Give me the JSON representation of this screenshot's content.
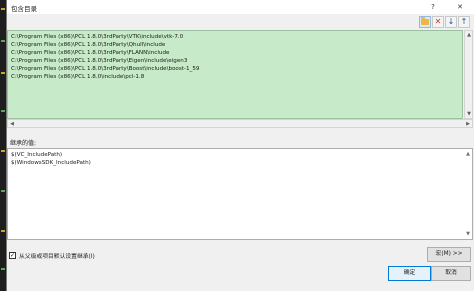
{
  "window": {
    "title": "包含目录",
    "help_glyph": "?",
    "close_glyph": "✕"
  },
  "toolbar": {
    "new_line_icon": "folder-icon",
    "delete_glyph": "✕",
    "move_down_glyph": "↓",
    "move_up_glyph": "↑"
  },
  "include_paths": [
    "C:\\Program Files (x86)\\PCL 1.8.0\\3rdParty\\VTK\\include\\vtk-7.0",
    "C:\\Program Files (x86)\\PCL 1.8.0\\3rdParty\\Qhull\\include",
    "C:\\Program Files (x86)\\PCL 1.8.0\\3rdParty\\FLANN\\include",
    "C:\\Program Files (x86)\\PCL 1.8.0\\3rdParty\\Eigen\\include\\eigen3",
    "C:\\Program Files (x86)\\PCL 1.8.0\\3rdParty\\Boost\\include\\boost-1_59",
    "C:\\Program Files (x86)\\PCL 1.8.0\\include\\pcl-1.8"
  ],
  "inherited": {
    "label": "继承的值:",
    "values": [
      "$(VC_IncludePath)",
      "$(WindowsSDK_IncludePath)"
    ]
  },
  "inherit_checkbox": {
    "label": "从父级或项目默认设置继承(I)",
    "checked_glyph": "✓"
  },
  "buttons": {
    "macros": "宏(M) >>",
    "ok": "确定",
    "cancel": "取消"
  },
  "scroll_glyphs": {
    "up": "▲",
    "down": "▼",
    "left": "◀",
    "right": "▶"
  },
  "colors": {
    "paths_background": "#c7eac8",
    "accent": "#0078d7"
  }
}
